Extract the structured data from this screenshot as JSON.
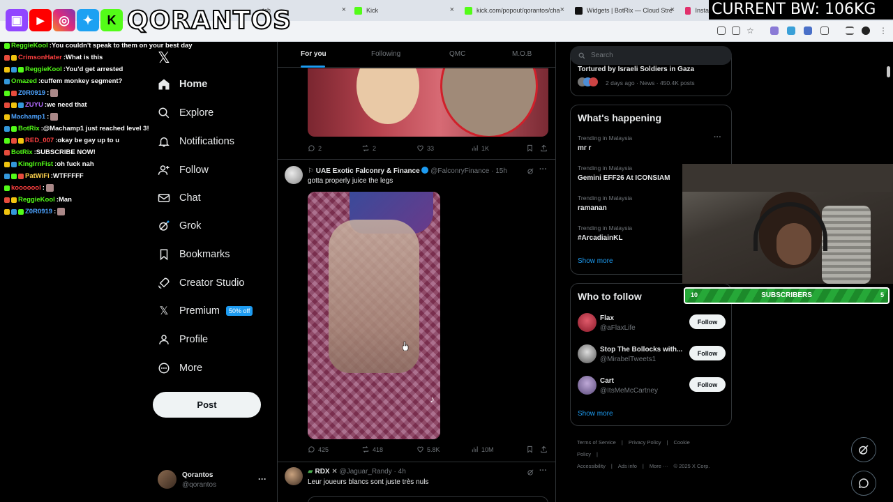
{
  "stream": {
    "brand": "QORANTOS",
    "bw_text": "CURRENT BW: 106KG",
    "subs": {
      "left": "10",
      "label": "SUBSCRIBERS",
      "right": "5"
    }
  },
  "browser": {
    "tabs": [
      {
        "title": "tch",
        "color": "#9146ff"
      },
      {
        "title": "Kick",
        "color": "#53fc18"
      },
      {
        "title": "kick.com/popout/qorantos/cha",
        "color": "#53fc18"
      },
      {
        "title": "Widgets | BotRix — Cloud Stre",
        "color": "#111111"
      },
      {
        "title": "Insta",
        "color": "#e1306c"
      }
    ]
  },
  "chat": [
    {
      "name": "ReggieKool",
      "color": "#53fc18",
      "msg": "You couldn't speak to them on your best day"
    },
    {
      "name": "CrimsonHater",
      "color": "#ff4040",
      "msg": "What is this"
    },
    {
      "name": "ReggieKool",
      "color": "#53fc18",
      "msg": "You'd get arrested"
    },
    {
      "name": "Omazed",
      "color": "#53fc18",
      "msg": "cuffem monkey segment?"
    },
    {
      "name": "Z0R0919",
      "color": "#4da3ff",
      "msg": ""
    },
    {
      "name": "ZUYU",
      "color": "#b36bff",
      "msg": "we need that"
    },
    {
      "name": "Machamp1",
      "color": "#4da3ff",
      "msg": ""
    },
    {
      "name": "BotRix",
      "color": "#53fc18",
      "msg": "@Machamp1 just reached level 3!"
    },
    {
      "name": "RED_007",
      "color": "#ff4040",
      "msg": "okay be gay up to u"
    },
    {
      "name": "BotRix",
      "color": "#53fc18",
      "msg": "SUBSCRIBE NOW!"
    },
    {
      "name": "KinglrnFist",
      "color": "#53fc18",
      "msg": "oh fuck nah"
    },
    {
      "name": "PatWiFi",
      "color": "#ffd24d",
      "msg": "WTFFFFF"
    },
    {
      "name": "kooooool",
      "color": "#ff4040",
      "msg": ""
    },
    {
      "name": "ReggieKool",
      "color": "#53fc18",
      "msg": "Man"
    },
    {
      "name": "Z0R0919",
      "color": "#4da3ff",
      "msg": ""
    }
  ],
  "nav": {
    "home": "Home",
    "explore": "Explore",
    "notifications": "Notifications",
    "follow": "Follow",
    "chat": "Chat",
    "grok": "Grok",
    "bookmarks": "Bookmarks",
    "creator_studio": "Creator Studio",
    "premium": "Premium",
    "premium_badge": "50% off",
    "profile": "Profile",
    "more": "More",
    "post": "Post"
  },
  "account": {
    "name": "Qorantos",
    "handle": "@qorantos"
  },
  "feed": {
    "tabs": [
      "For you",
      "Following",
      "QMC",
      "M.O.B"
    ],
    "post1_stats": {
      "replies": "2",
      "reposts": "2",
      "likes": "33",
      "views": "1K"
    },
    "post2": {
      "name": "UAE Exotic Falconry & Finance",
      "handle": "@FalconryFinance · 15h",
      "text": "gotta properly juice the legs",
      "stats": {
        "replies": "425",
        "reposts": "418",
        "likes": "5.8K",
        "views": "10M"
      }
    },
    "post3": {
      "name": "RDX",
      "handle": "@Jaguar_Randy · 4h",
      "text": "Leur joueurs blancs sont juste très nuls"
    }
  },
  "right": {
    "search_placeholder": "Search",
    "news": {
      "title": "Tortured by Israeli Soldiers in Gaza",
      "meta": "2 days ago · News · 450.4K posts"
    },
    "happening_title": "What's happening",
    "trends": [
      {
        "context": "Trending in Malaysia",
        "name": "mr r"
      },
      {
        "context": "Trending in Malaysia",
        "name": "Gemini EFF26 At ICONSIAM"
      },
      {
        "context": "Trending in Malaysia",
        "name": "ramanan"
      },
      {
        "context": "Trending in Malaysia",
        "name": "#ArcadiainKL"
      }
    ],
    "show_more": "Show more",
    "who_title": "Who to follow",
    "who": [
      {
        "name": "Flax",
        "handle": "@aFlaxLife",
        "button": "Follow"
      },
      {
        "name": "Stop The Bollocks with...",
        "handle": "@MirabelTweets1",
        "button": "Follow"
      },
      {
        "name": "Cart",
        "handle": "@ItsMeMcCartney",
        "button": "Follow"
      }
    ],
    "footer": [
      "Terms of Service",
      "|",
      "Privacy Policy",
      "|",
      "Cookie Policy",
      "|",
      "Accessibility",
      "|",
      "Ads info",
      "|",
      "More ···",
      "© 2025 X Corp."
    ]
  }
}
